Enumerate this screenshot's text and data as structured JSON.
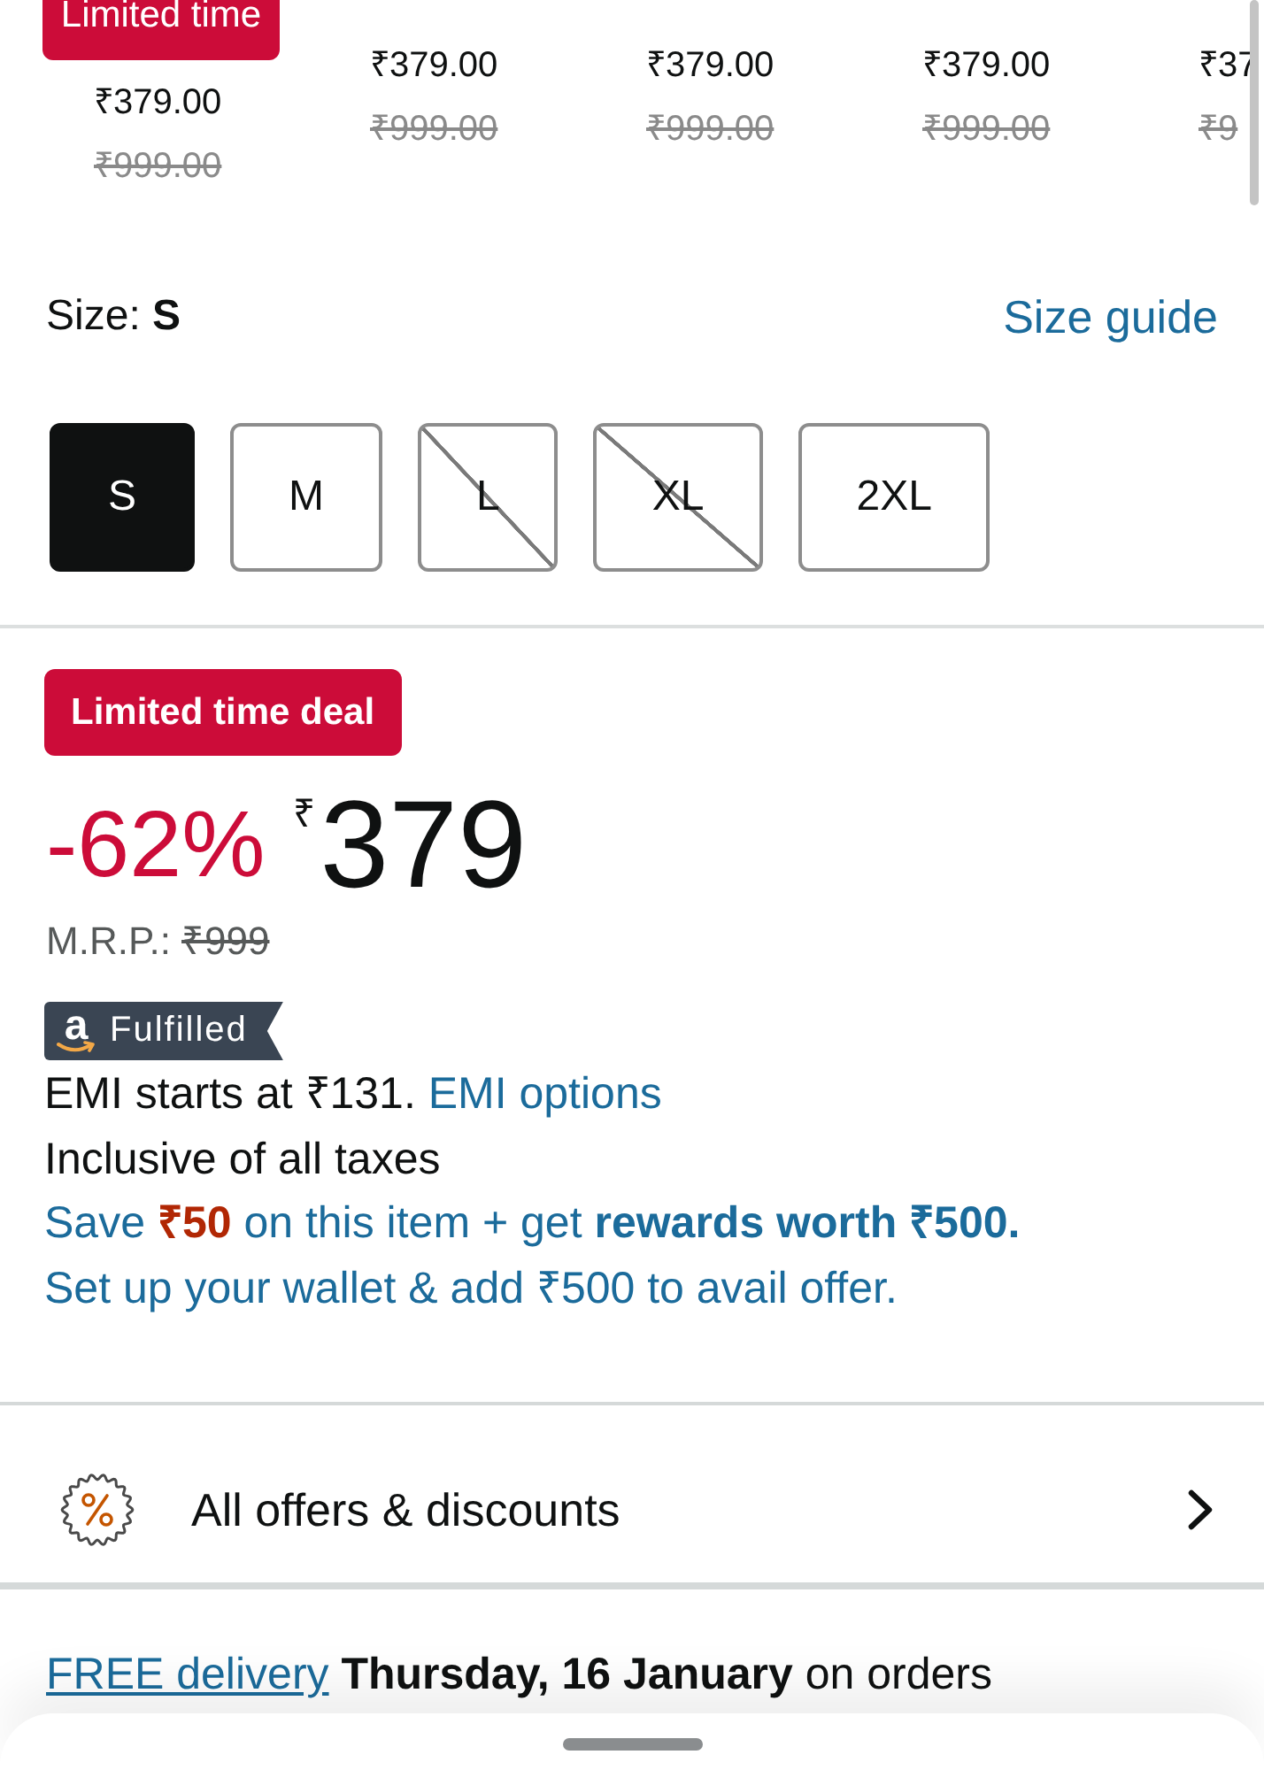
{
  "variants": [
    {
      "badge": "Limited time",
      "price": "₹379.00",
      "mrp": "₹999.00"
    },
    {
      "price": "₹379.00",
      "mrp": "₹999.00"
    },
    {
      "price": "₹379.00",
      "mrp": "₹999.00"
    },
    {
      "price": "₹379.00",
      "mrp": "₹999.00"
    },
    {
      "price": "₹37",
      "mrp": "₹9"
    }
  ],
  "size": {
    "label": "Size: **S**",
    "guide_link": "Size guide",
    "options": [
      {
        "label": "S",
        "selected": true,
        "available": true
      },
      {
        "label": "M",
        "selected": false,
        "available": true
      },
      {
        "label": "L",
        "selected": false,
        "available": false
      },
      {
        "label": "XL",
        "selected": false,
        "available": false
      },
      {
        "label": "2XL",
        "selected": false,
        "available": true
      }
    ]
  },
  "deal": {
    "badge": "Limited time deal",
    "discount": "-62%",
    "currency": "₹",
    "amount": "379",
    "mrp_label": "M.R.P.:",
    "mrp_value": "₹999"
  },
  "fulfilled": {
    "logo_letter": "a",
    "label": "Fulfilled"
  },
  "emi": {
    "text": "EMI starts at ₹131.",
    "link": "EMI options"
  },
  "tax_note": "Inclusive of all taxes",
  "wallet_offer": {
    "headline": [
      {
        "text": "Save ",
        "kind": "plain"
      },
      {
        "text": "₹50",
        "kind": "saving"
      },
      {
        "text": " on this item + get ",
        "kind": "plain"
      },
      {
        "text": "rewards worth ₹500.",
        "kind": "bold"
      }
    ],
    "detail": "Set up your wallet & add ₹500 to avail offer."
  },
  "offers_row": {
    "label": "All offers & discounts"
  },
  "delivery": {
    "link": "FREE delivery",
    "date": "Thursday, 16 January",
    "suffix": "on orders"
  }
}
